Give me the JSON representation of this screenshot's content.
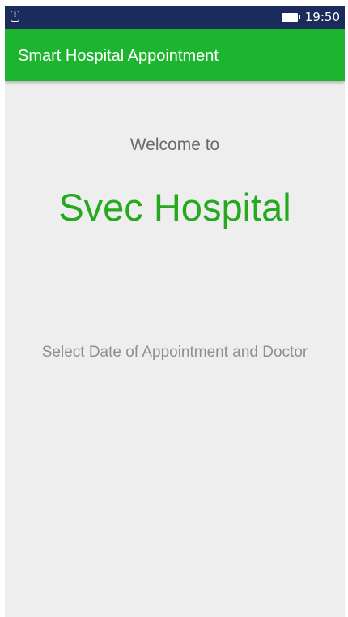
{
  "status_bar": {
    "alert_icon": "alert-notification-icon",
    "alert_glyph": "!",
    "battery_icon": "battery-full-icon",
    "time": "19:50",
    "background": "#1b2c5c"
  },
  "app_bar": {
    "title": "Smart Hospital Appointment",
    "background": "#1db530"
  },
  "main": {
    "welcome_label": "Welcome to",
    "hospital_name": "Svec Hospital",
    "select_prompt": "Select Date of Appointment and Doctor",
    "accent_color": "#26a81f",
    "background": "#eeeeee"
  }
}
